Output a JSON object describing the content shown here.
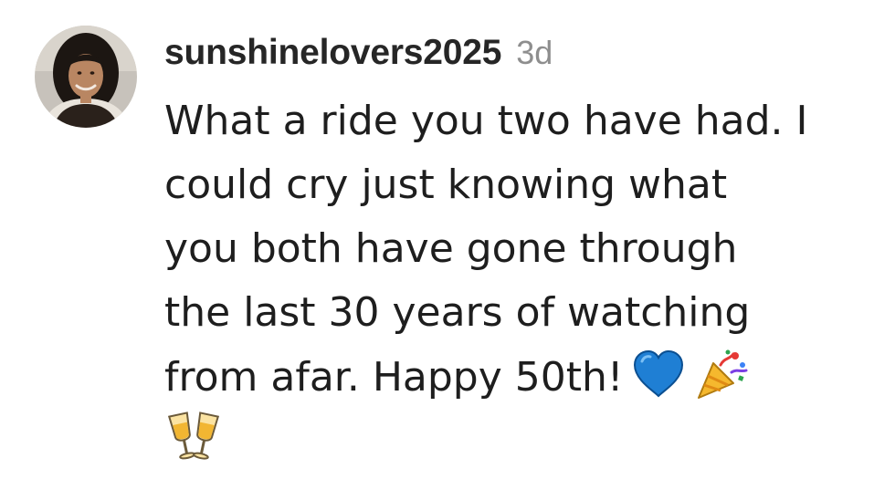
{
  "comment": {
    "username": "sunshinelovers2025",
    "timestamp": "3d",
    "text_lines": [
      "What a ride you two have had. I",
      "could cry just knowing what",
      "you both have gone through",
      "the last 30 years of watching",
      "from afar. Happy 50th!"
    ],
    "emojis": [
      "blue-heart",
      "party-popper",
      "clinking-glasses"
    ]
  }
}
